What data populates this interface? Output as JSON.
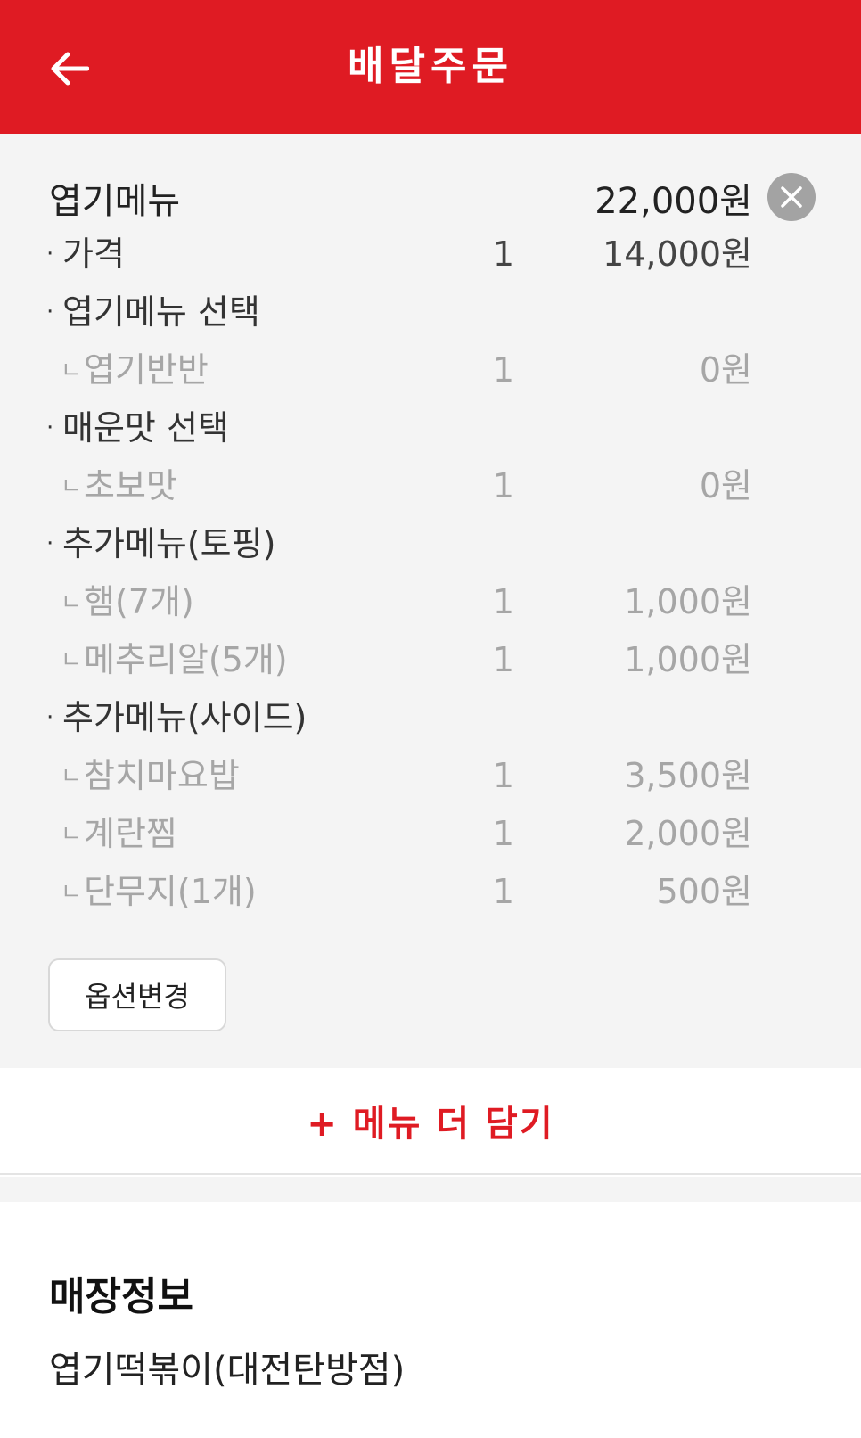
{
  "header": {
    "title": "배달주문",
    "back_icon": "arrow-left-icon",
    "bg_color": "#df1b23"
  },
  "cart_item": {
    "name": "엽기메뉴",
    "total": "22,000원",
    "remove_icon": "close-icon",
    "base_price": {
      "label": "가격",
      "qty": "1",
      "price": "14,000원"
    },
    "groups": [
      {
        "label": "엽기메뉴 선택",
        "options": [
          {
            "label": "엽기반반",
            "qty": "1",
            "price": "0원"
          }
        ]
      },
      {
        "label": "매운맛 선택",
        "options": [
          {
            "label": "초보맛",
            "qty": "1",
            "price": "0원"
          }
        ]
      },
      {
        "label": "추가메뉴(토핑)",
        "options": [
          {
            "label": "햄(7개)",
            "qty": "1",
            "price": "1,000원"
          },
          {
            "label": "메추리알(5개)",
            "qty": "1",
            "price": "1,000원"
          }
        ]
      },
      {
        "label": "추가메뉴(사이드)",
        "options": [
          {
            "label": "참치마요밥",
            "qty": "1",
            "price": "3,500원"
          },
          {
            "label": "계란찜",
            "qty": "1",
            "price": "2,000원"
          },
          {
            "label": "단무지(1개)",
            "qty": "1",
            "price": "500원"
          }
        ]
      }
    ],
    "change_option_label": "옵션변경"
  },
  "add_more": {
    "label": "+ 메뉴 더 담기",
    "color": "#df1b23"
  },
  "store": {
    "title": "매장정보",
    "name": "엽기떡볶이(대전탄방점)"
  }
}
